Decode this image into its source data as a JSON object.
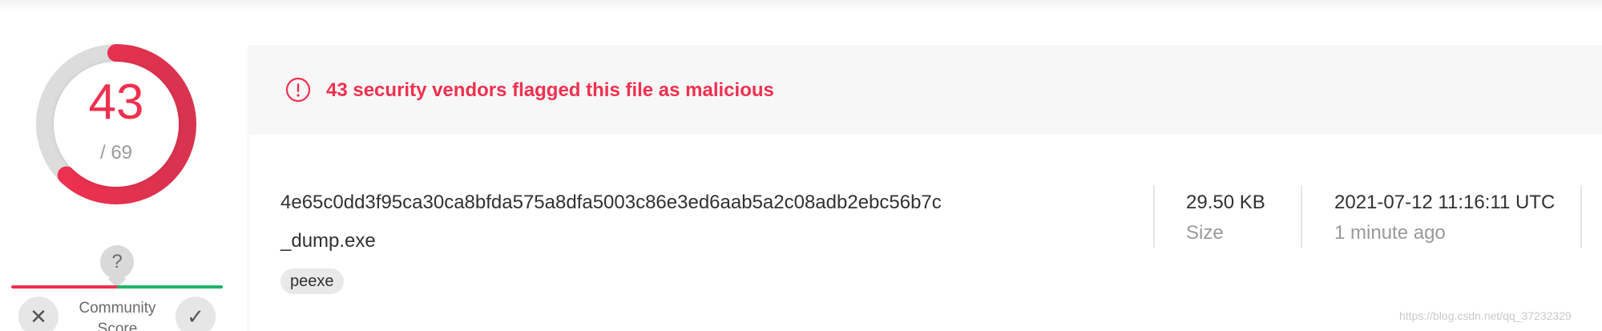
{
  "detection": {
    "positives": "43",
    "total": "/ 69",
    "ratio": 0.623,
    "colors": {
      "malicious": "#f0304f",
      "ring_track": "#dcdcdc",
      "harmless": "#21b36a"
    }
  },
  "community": {
    "bubble": "?",
    "label": "Community Score",
    "downvote_icon": "close-icon",
    "upvote_icon": "check-icon"
  },
  "alert": {
    "icon": "exclamation-circle-icon",
    "text": "43 security vendors flagged this file as malicious"
  },
  "file": {
    "hash": "4e65c0dd3f95ca30ca8bfda575a8dfa5003c86e3ed6aab5a2c08adb2ebc56b7c",
    "name": "_dump.exe",
    "tags": [
      "peexe"
    ]
  },
  "meta": {
    "size_value": "29.50 KB",
    "size_label": "Size",
    "date_value": "2021-07-12 11:16:11 UTC",
    "date_label": "1 minute ago"
  },
  "watermark": "https://blog.csdn.net/qq_37232329"
}
